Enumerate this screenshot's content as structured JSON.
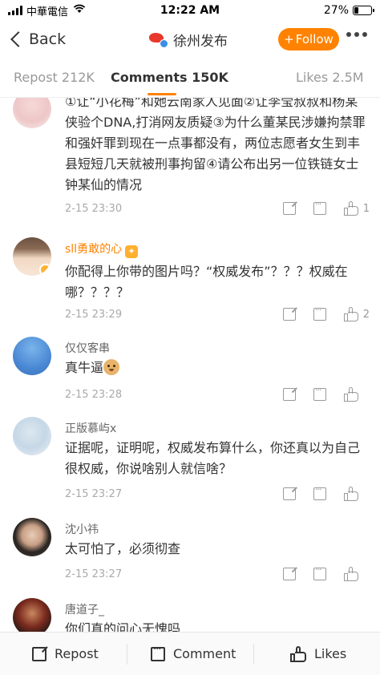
{
  "status_bar": {
    "carrier": "中華電信",
    "time": "12:22 AM",
    "battery": "27%",
    "battery_level": 0.27
  },
  "nav": {
    "back_label": "Back",
    "account_name": "徐州发布",
    "follow_label": "Follow",
    "follow_prefix": "+"
  },
  "tabs": [
    {
      "label": "Repost 212K"
    },
    {
      "label": "Comments 150K"
    },
    {
      "label": "Likes 2.5M"
    }
  ],
  "comments": [
    {
      "username": "",
      "text": "①让“小花梅”和她云南家人见面②让李莹叔叔和杨某侠验个DNA,打消网友质疑③为什么董某民涉嫌拘禁罪和强奸罪到现在一点事都没有，两位志愿者女生到丰县短短几天就被刑事拘留④请公布出另一位铁链女士钟某仙的情况",
      "time": "2-15 23:30",
      "likes": "1"
    },
    {
      "username": "sll勇敢的心",
      "text": "你配得上你带的图片吗？“权威发布”？？？权威在哪？？？？",
      "time": "2-15 23:29",
      "likes": "2"
    },
    {
      "username": "仅仅客串",
      "text": "真牛逼",
      "time": "2-15 23:28",
      "likes": ""
    },
    {
      "username": "正版慕屿x",
      "text": "证据呢，证明呢，权威发布算什么，你还真以为自己很权威，你说啥别人就信啥？",
      "time": "2-15 23:27",
      "likes": ""
    },
    {
      "username": "沈小祎",
      "text": "太可怕了，必须彻查",
      "time": "2-15 23:27",
      "likes": ""
    },
    {
      "username": "唐道子_",
      "text": "你们真的问心无愧吗",
      "time": "",
      "likes": ""
    }
  ],
  "bottom_bar": {
    "repost_label": "Repost",
    "comment_label": "Comment",
    "likes_label": "Likes"
  },
  "colors": {
    "accent": "#ff8200",
    "vip_name": "#ff8200",
    "muted_text": "#999999"
  }
}
